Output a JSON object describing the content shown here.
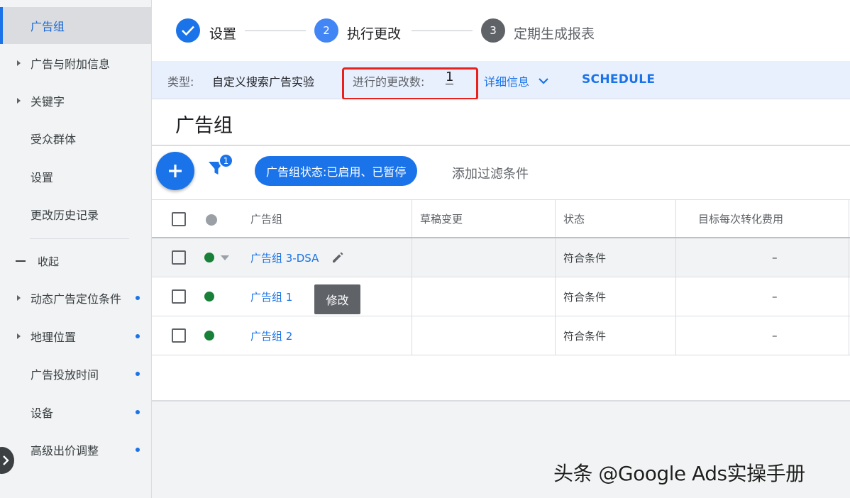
{
  "sidebar": {
    "items": [
      {
        "label": "广告组"
      },
      {
        "label": "广告与附加信息"
      },
      {
        "label": "关键字"
      },
      {
        "label": "受众群体"
      },
      {
        "label": "设置"
      },
      {
        "label": "更改历史记录"
      }
    ],
    "collapse_label": "收起",
    "more_items": [
      {
        "label": "动态广告定位条件"
      },
      {
        "label": "地理位置"
      },
      {
        "label": "广告投放时间"
      },
      {
        "label": "设备"
      },
      {
        "label": "高级出价调整"
      }
    ]
  },
  "stepper": {
    "steps": [
      {
        "label": "设置",
        "status": "done"
      },
      {
        "label": "执行更改",
        "number": "2",
        "status": "active"
      },
      {
        "label": "定期生成报表",
        "number": "3",
        "status": "upcoming"
      }
    ]
  },
  "infobar": {
    "type_label": "类型:",
    "type_value": "自定义搜索广告实验",
    "changes_label": "进行的更改数:",
    "changes_count": "1",
    "details_label": "详细信息",
    "schedule_label": "SCHEDULE"
  },
  "main": {
    "title": "广告组",
    "filter_badge": "1",
    "filter_chip": "广告组状态:已启用、已暂停",
    "add_filter": "添加过滤条件"
  },
  "table": {
    "headers": [
      "广告组",
      "草稿变更",
      "状态",
      "目标每次转化费用"
    ],
    "rows": [
      {
        "name": "广告组 3-DSA",
        "draft": "",
        "status": "符合条件",
        "cpa": "–"
      },
      {
        "name": "广告组 1",
        "draft": "",
        "status": "符合条件",
        "cpa": "–"
      },
      {
        "name": "广告组 2",
        "draft": "",
        "status": "符合条件",
        "cpa": "–"
      }
    ],
    "tooltip": "修改"
  },
  "watermark": "头条 @Google Ads实操手册",
  "colors": {
    "accent": "#1a73e8",
    "status_green": "#188038",
    "highlight_red": "#e8211d"
  }
}
